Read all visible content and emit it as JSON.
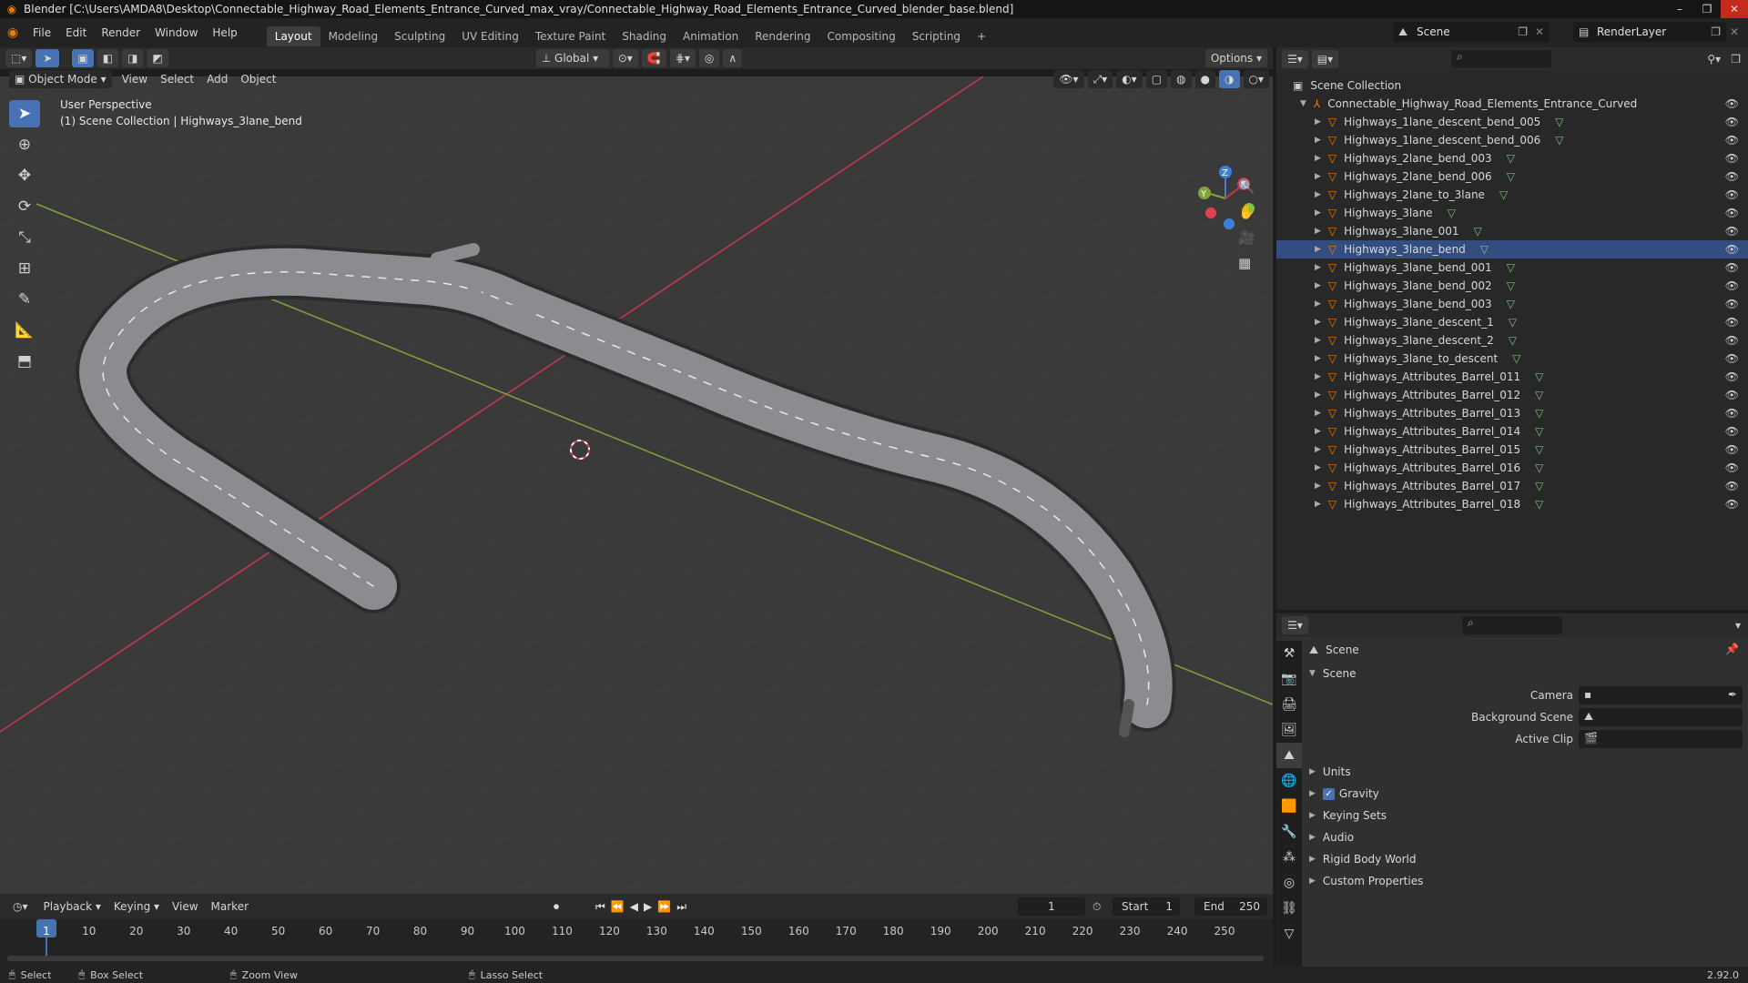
{
  "window": {
    "title": "Blender [C:\\Users\\AMDA8\\Desktop\\Connectable_Highway_Road_Elements_Entrance_Curved_max_vray/Connectable_Highway_Road_Elements_Entrance_Curved_blender_base.blend]",
    "min": "–",
    "max": "❐",
    "close": "✕"
  },
  "menu": [
    "File",
    "Edit",
    "Render",
    "Window",
    "Help"
  ],
  "workspaces": [
    "Layout",
    "Modeling",
    "Sculpting",
    "UV Editing",
    "Texture Paint",
    "Shading",
    "Animation",
    "Rendering",
    "Compositing",
    "Scripting"
  ],
  "workspace_add": "+",
  "active_workspace": "Layout",
  "scene_name": "Scene",
  "view_layer": "RenderLayer",
  "viewport": {
    "mode": "Object Mode",
    "menus": [
      "View",
      "Select",
      "Add",
      "Object"
    ],
    "transform": "Global",
    "options": "Options",
    "info_line1": "User Perspective",
    "info_line2": "(1) Scene Collection | Highways_3lane_bend",
    "gizmo_x": "X",
    "gizmo_y": "Y",
    "gizmo_z": "Z"
  },
  "outliner": {
    "root": "Scene Collection",
    "collection": "Connectable_Highway_Road_Elements_Entrance_Curved",
    "items": [
      "Highways_1lane_descent_bend_005",
      "Highways_1lane_descent_bend_006",
      "Highways_2lane_bend_003",
      "Highways_2lane_bend_006",
      "Highways_2lane_to_3lane",
      "Highways_3lane",
      "Highways_3lane_001",
      "Highways_3lane_bend",
      "Highways_3lane_bend_001",
      "Highways_3lane_bend_002",
      "Highways_3lane_bend_003",
      "Highways_3lane_descent_1",
      "Highways_3lane_descent_2",
      "Highways_3lane_to_descent",
      "Highways_Attributes_Barrel_011",
      "Highways_Attributes_Barrel_012",
      "Highways_Attributes_Barrel_013",
      "Highways_Attributes_Barrel_014",
      "Highways_Attributes_Barrel_015",
      "Highways_Attributes_Barrel_016",
      "Highways_Attributes_Barrel_017",
      "Highways_Attributes_Barrel_018"
    ],
    "selected_index": 7
  },
  "properties": {
    "context": "Scene",
    "panel": "Scene",
    "camera_label": "Camera",
    "bg_scene_label": "Background Scene",
    "active_clip_label": "Active Clip",
    "sections": [
      "Units",
      "Gravity",
      "Keying Sets",
      "Audio",
      "Rigid Body World",
      "Custom Properties"
    ],
    "gravity_checked": true
  },
  "timeline": {
    "menus": [
      "Playback",
      "Keying",
      "View",
      "Marker"
    ],
    "current_frame": "1",
    "start_label": "Start",
    "start": "1",
    "end_label": "End",
    "end": "250",
    "ticks": [
      "1",
      "10",
      "20",
      "30",
      "40",
      "50",
      "60",
      "70",
      "80",
      "90",
      "100",
      "110",
      "120",
      "130",
      "140",
      "150",
      "160",
      "170",
      "180",
      "190",
      "200",
      "210",
      "220",
      "230",
      "240",
      "250"
    ]
  },
  "status": {
    "select": "Select",
    "box_select": "Box Select",
    "zoom_view": "Zoom View",
    "lasso_select": "Lasso Select",
    "version": "2.92.0"
  },
  "colors": {
    "accent": "#4772b3",
    "object_orange": "#e87d0d",
    "mesh_green": "#7ec37e",
    "x_axis": "#c5384b",
    "y_axis": "#7fa53a",
    "z_axis": "#3d7fd9"
  }
}
